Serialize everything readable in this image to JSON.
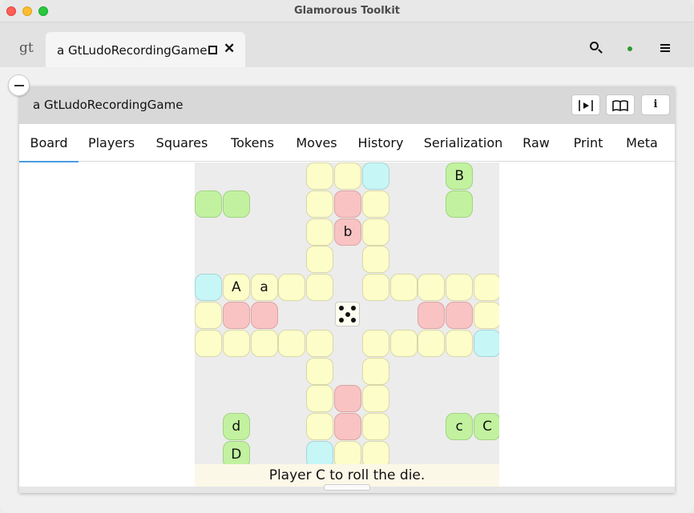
{
  "window": {
    "title": "Glamorous Toolkit"
  },
  "tabbar": {
    "logo": "gt",
    "tab_label": "a GtLudoRecordingGame",
    "icons": [
      "search-icon",
      "status-dot-icon",
      "menu-icon"
    ]
  },
  "inspector": {
    "title": "a GtLudoRecordingGame",
    "header_icons": [
      "play-inspect-icon",
      "book-icon",
      "info-icon"
    ],
    "tabs": [
      {
        "label": "Board"
      },
      {
        "label": "Players"
      },
      {
        "label": "Squares"
      },
      {
        "label": "Tokens"
      },
      {
        "label": "Moves"
      },
      {
        "label": "History"
      },
      {
        "label": "Serialization"
      },
      {
        "label": "Raw"
      },
      {
        "label": "Print"
      },
      {
        "label": "Meta"
      }
    ],
    "active_tab": "Board"
  },
  "board": {
    "colors": {
      "yellow": "#fdfdc9",
      "pink": "#f9c3c3",
      "green": "#c2f2a0",
      "blue": "#c7f6f6",
      "background": "#ececec"
    },
    "die_value": 5,
    "squares": [
      {
        "r": 0,
        "c": 4,
        "k": "y"
      },
      {
        "r": 0,
        "c": 5,
        "k": "y"
      },
      {
        "r": 0,
        "c": 6,
        "k": "b"
      },
      {
        "r": 0,
        "c": 9,
        "k": "g",
        "label": "B"
      },
      {
        "r": 1,
        "c": 0,
        "k": "g"
      },
      {
        "r": 1,
        "c": 1,
        "k": "g"
      },
      {
        "r": 1,
        "c": 4,
        "k": "y"
      },
      {
        "r": 1,
        "c": 5,
        "k": "p"
      },
      {
        "r": 1,
        "c": 6,
        "k": "y"
      },
      {
        "r": 1,
        "c": 9,
        "k": "g"
      },
      {
        "r": 2,
        "c": 4,
        "k": "y"
      },
      {
        "r": 2,
        "c": 5,
        "k": "p",
        "label": "b"
      },
      {
        "r": 2,
        "c": 6,
        "k": "y"
      },
      {
        "r": 3,
        "c": 4,
        "k": "y"
      },
      {
        "r": 3,
        "c": 6,
        "k": "y"
      },
      {
        "r": 4,
        "c": 0,
        "k": "b"
      },
      {
        "r": 4,
        "c": 1,
        "k": "y",
        "label": "A"
      },
      {
        "r": 4,
        "c": 2,
        "k": "y",
        "label": "a"
      },
      {
        "r": 4,
        "c": 3,
        "k": "y"
      },
      {
        "r": 4,
        "c": 4,
        "k": "y"
      },
      {
        "r": 4,
        "c": 6,
        "k": "y"
      },
      {
        "r": 4,
        "c": 7,
        "k": "y"
      },
      {
        "r": 4,
        "c": 8,
        "k": "y"
      },
      {
        "r": 4,
        "c": 9,
        "k": "y"
      },
      {
        "r": 4,
        "c": 10,
        "k": "y"
      },
      {
        "r": 5,
        "c": 0,
        "k": "y"
      },
      {
        "r": 5,
        "c": 1,
        "k": "p"
      },
      {
        "r": 5,
        "c": 2,
        "k": "p"
      },
      {
        "r": 5,
        "c": 8,
        "k": "p"
      },
      {
        "r": 5,
        "c": 9,
        "k": "p"
      },
      {
        "r": 5,
        "c": 10,
        "k": "y"
      },
      {
        "r": 6,
        "c": 0,
        "k": "y"
      },
      {
        "r": 6,
        "c": 1,
        "k": "y"
      },
      {
        "r": 6,
        "c": 2,
        "k": "y"
      },
      {
        "r": 6,
        "c": 3,
        "k": "y"
      },
      {
        "r": 6,
        "c": 4,
        "k": "y"
      },
      {
        "r": 6,
        "c": 6,
        "k": "y"
      },
      {
        "r": 6,
        "c": 7,
        "k": "y"
      },
      {
        "r": 6,
        "c": 8,
        "k": "y"
      },
      {
        "r": 6,
        "c": 9,
        "k": "y"
      },
      {
        "r": 6,
        "c": 10,
        "k": "b"
      },
      {
        "r": 7,
        "c": 4,
        "k": "y"
      },
      {
        "r": 7,
        "c": 6,
        "k": "y"
      },
      {
        "r": 8,
        "c": 4,
        "k": "y"
      },
      {
        "r": 8,
        "c": 5,
        "k": "p"
      },
      {
        "r": 8,
        "c": 6,
        "k": "y"
      },
      {
        "r": 9,
        "c": 1,
        "k": "g",
        "label": "d"
      },
      {
        "r": 9,
        "c": 4,
        "k": "y"
      },
      {
        "r": 9,
        "c": 5,
        "k": "p"
      },
      {
        "r": 9,
        "c": 6,
        "k": "y"
      },
      {
        "r": 9,
        "c": 9,
        "k": "g",
        "label": "c"
      },
      {
        "r": 9,
        "c": 10,
        "k": "g",
        "label": "C"
      },
      {
        "r": 10,
        "c": 1,
        "k": "g",
        "label": "D"
      },
      {
        "r": 10,
        "c": 4,
        "k": "b"
      },
      {
        "r": 10,
        "c": 5,
        "k": "y"
      },
      {
        "r": 10,
        "c": 6,
        "k": "y"
      }
    ],
    "status": "Player C to roll the die."
  }
}
